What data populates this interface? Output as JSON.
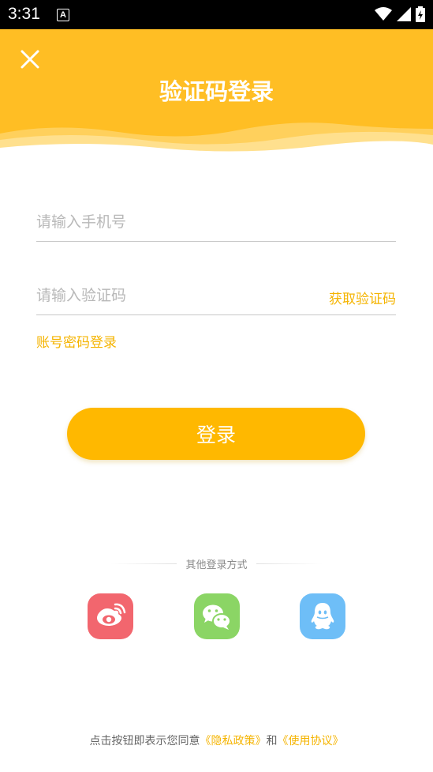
{
  "status_bar": {
    "time": "3:31",
    "notification_icon": "A"
  },
  "header": {
    "title": "验证码登录"
  },
  "form": {
    "phone_placeholder": "请输入手机号",
    "code_placeholder": "请输入验证码",
    "get_code_label": "获取验证码",
    "account_login_label": "账号密码登录",
    "login_label": "登录"
  },
  "other": {
    "label": "其他登录方式",
    "providers": [
      "weibo-icon",
      "wechat-icon",
      "qq-icon"
    ]
  },
  "footer": {
    "prefix": "点击按钮即表示您同意",
    "privacy": "《隐私政策》",
    "and": "和",
    "terms": "《使用协议》"
  },
  "colors": {
    "accent": "#FFBE24",
    "button": "#FFB800",
    "link": "#F5B400"
  }
}
